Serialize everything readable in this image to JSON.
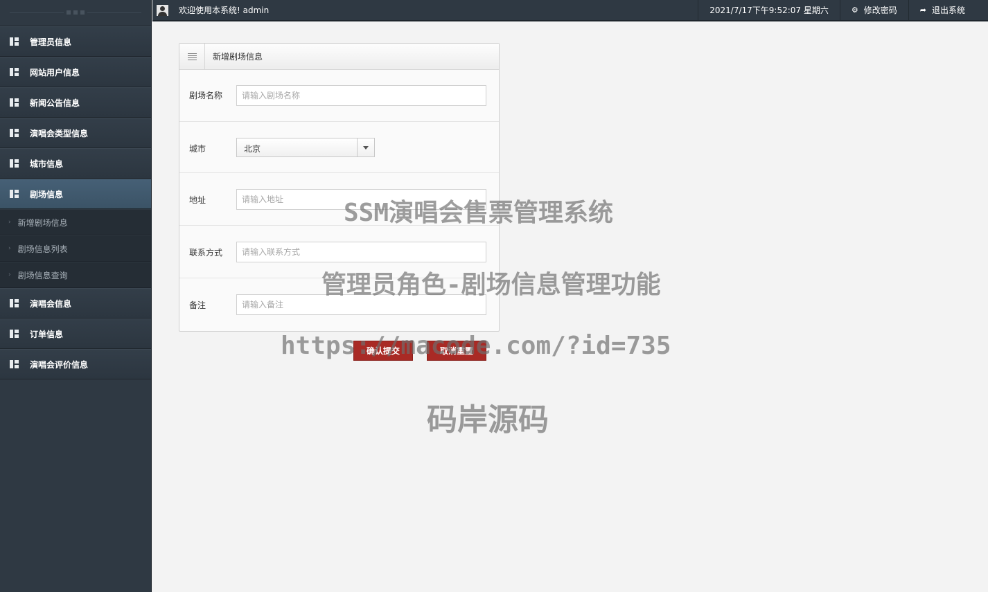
{
  "sidebar": {
    "items": [
      {
        "label": "管理员信息"
      },
      {
        "label": "网站用户信息"
      },
      {
        "label": "新闻公告信息"
      },
      {
        "label": "演唱会类型信息"
      },
      {
        "label": "城市信息"
      },
      {
        "label": "剧场信息"
      },
      {
        "label": "演唱会信息"
      },
      {
        "label": "订单信息"
      },
      {
        "label": "演唱会评价信息"
      }
    ],
    "subitems": [
      {
        "label": "新增剧场信息"
      },
      {
        "label": "剧场信息列表"
      },
      {
        "label": "剧场信息查询"
      }
    ]
  },
  "header": {
    "welcome": "欢迎使用本系统! admin",
    "datetime": "2021/7/17下午9:52:07 星期六",
    "change_password": "修改密码",
    "logout": "退出系统"
  },
  "form": {
    "title": "新增剧场信息",
    "name": {
      "label": "剧场名称",
      "placeholder": "请输入剧场名称"
    },
    "city": {
      "label": "城市",
      "value": "北京"
    },
    "address": {
      "label": "地址",
      "placeholder": "请输入地址"
    },
    "contact": {
      "label": "联系方式",
      "placeholder": "请输入联系方式"
    },
    "remark": {
      "label": "备注",
      "placeholder": "请输入备注"
    },
    "submit": "确认提交",
    "reset": "取消重置"
  },
  "watermark": {
    "line1": "SSM演唱会售票管理系统",
    "line2": "管理员角色-剧场信息管理功能",
    "line3": "https://macode.com/?id=735",
    "line4": "码岸源码"
  }
}
